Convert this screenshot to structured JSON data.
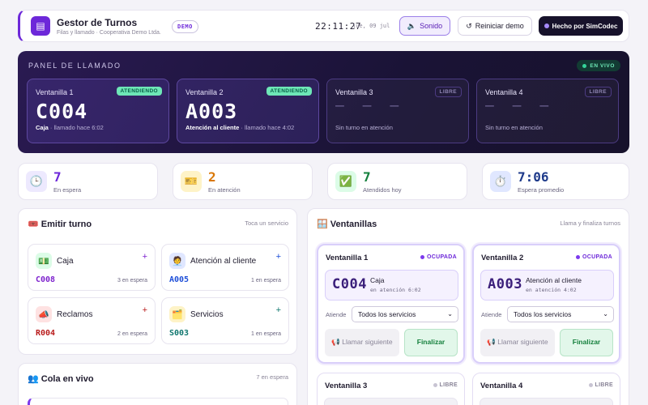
{
  "header": {
    "logo_icon": "ticket-icon",
    "title": "Gestor de Turnos",
    "subtitle": "Filas y llamado · Cooperativa Demo Ltda.",
    "demo_badge": "DEMO",
    "clock": "22:11:27",
    "date": "jue, 09 jul",
    "sound_label": "Sonido",
    "sound_icon": "🔈",
    "reset_label": "Reiniciar demo",
    "reset_icon": "↺",
    "made_by_label": "Hecho por SimCodec"
  },
  "panel": {
    "title": "PANEL DE LLAMADO",
    "live_badge": "EN VIVO",
    "windows": [
      {
        "name": "Ventanilla 1",
        "status": "ATENDIENDO",
        "code": "C004",
        "service": "Caja",
        "detail": " · llamado hace 6:02"
      },
      {
        "name": "Ventanilla 2",
        "status": "ATENDIENDO",
        "code": "A003",
        "service": "Atención al cliente",
        "detail": " · llamado hace 4:02"
      },
      {
        "name": "Ventanilla 3",
        "status": "LIBRE",
        "dash": "— — —",
        "detail": "Sin turno en atención"
      },
      {
        "name": "Ventanilla 4",
        "status": "LIBRE",
        "dash": "— — —",
        "detail": "Sin turno en atención"
      }
    ]
  },
  "stats": [
    {
      "icon": "🕒",
      "icon_name": "clock-icon",
      "value": "7",
      "label": "En espera",
      "color": "#6d28d9",
      "bg": "#ede9fe"
    },
    {
      "icon": "🎫",
      "icon_name": "ticket-icon",
      "value": "2",
      "label": "En atención",
      "color": "#d97706",
      "bg": "#fef3c7"
    },
    {
      "icon": "✅",
      "icon_name": "check-icon",
      "value": "7",
      "label": "Atendidos hoy",
      "color": "#15803d",
      "bg": "#dcfce7"
    },
    {
      "icon": "⏱️",
      "icon_name": "stopwatch-icon",
      "value": "7:06",
      "label": "Espera promedio",
      "color": "#1e3a8a",
      "bg": "#e0e7ff"
    }
  ],
  "emit": {
    "title": "Emitir turno",
    "title_icon": "🎟️",
    "note": "Toca un servicio",
    "services": [
      {
        "name": "Caja",
        "icon": "💵",
        "code": "C008",
        "waiting": "3 en espera",
        "color": "#7e22ce",
        "bg": "#dcfce7",
        "plus_color": "#7e22ce"
      },
      {
        "name": "Atención al cliente",
        "icon": "🧑‍💼",
        "code": "A005",
        "waiting": "1 en espera",
        "color": "#1d4ed8",
        "bg": "#e0e7ff",
        "plus_color": "#1d4ed8"
      },
      {
        "name": "Reclamos",
        "icon": "📣",
        "code": "R004",
        "waiting": "2 en espera",
        "color": "#b91c1c",
        "bg": "#fee2e2",
        "plus_color": "#b91c1c"
      },
      {
        "name": "Servicios",
        "icon": "🗂️",
        "code": "S003",
        "waiting": "1 en espera",
        "color": "#0f766e",
        "bg": "#fef3c7",
        "plus_color": "#0f766e"
      }
    ]
  },
  "queue": {
    "title": "Cola en vivo",
    "title_icon": "👥",
    "count": "7 en espera"
  },
  "ventanillas": {
    "title": "Ventanillas",
    "title_icon": "🪟",
    "note": "Llama y finaliza turnos",
    "attend_label": "Atiende",
    "select_value": "Todos los servicios",
    "call_label": "📢 Llamar siguiente",
    "finish_label": "Finalizar",
    "windows": [
      {
        "name": "Ventanilla 1",
        "status": "OCUPADA",
        "code": "C004",
        "service": "Caja",
        "since": "en atención 6:02"
      },
      {
        "name": "Ventanilla 2",
        "status": "OCUPADA",
        "code": "A003",
        "service": "Atención al cliente",
        "since": "en atención 4:02"
      },
      {
        "name": "Ventanilla 3",
        "status": "LIBRE"
      },
      {
        "name": "Ventanilla 4",
        "status": "LIBRE"
      }
    ]
  }
}
